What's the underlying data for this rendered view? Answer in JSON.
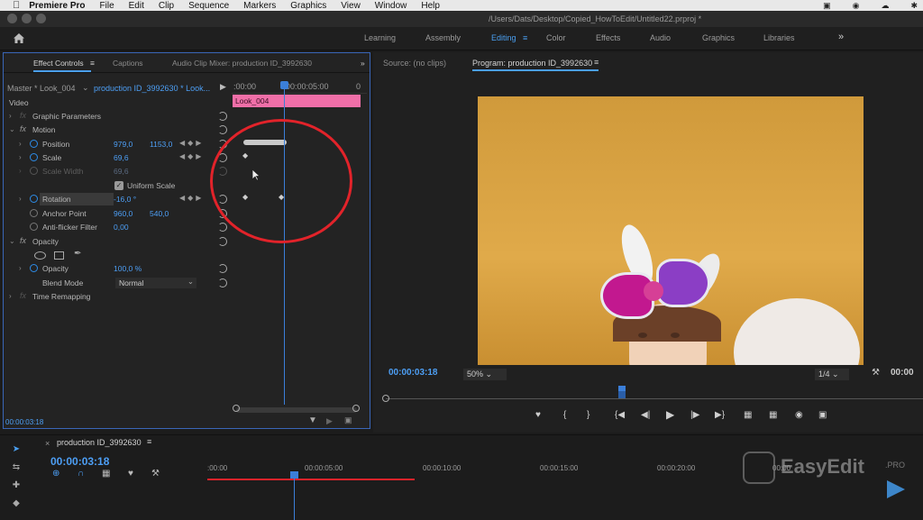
{
  "menubar": {
    "app": "Premiere Pro",
    "items": [
      "File",
      "Edit",
      "Clip",
      "Sequence",
      "Markers",
      "Graphics",
      "View",
      "Window",
      "Help"
    ]
  },
  "window": {
    "path": "/Users/Dats/Desktop/Copied_HowToEdit/Untitled22.prproj *"
  },
  "workspaces": {
    "tabs": [
      "Learning",
      "Assembly",
      "Editing",
      "Color",
      "Effects",
      "Audio",
      "Graphics",
      "Libraries"
    ],
    "active": "Editing",
    "more": "»"
  },
  "effect_controls": {
    "tabs": [
      "Effect Controls",
      "Captions",
      "Audio Clip Mixer: production ID_3992630"
    ],
    "more": "»",
    "master": "Master * Look_004",
    "sequence": "production ID_3992630 * Look...",
    "ruler": {
      "start": ":00:00",
      "mid": "00:00:05:00",
      "end": "0"
    },
    "clip_label": "Look_004",
    "section_video": "Video",
    "graphic_parameters": "Graphic Parameters",
    "motion": "Motion",
    "position": {
      "label": "Position",
      "x": "979,0",
      "y": "1153,0"
    },
    "scale": {
      "label": "Scale",
      "value": "69,6"
    },
    "scale_width": {
      "label": "Scale Width",
      "value": "69,6"
    },
    "uniform_scale": "Uniform Scale",
    "rotation": {
      "label": "Rotation",
      "value": "-16,0 °"
    },
    "anchor_point": {
      "label": "Anchor Point",
      "x": "960,0",
      "y": "540,0"
    },
    "anti_flicker": {
      "label": "Anti-flicker Filter",
      "value": "0,00"
    },
    "opacity_section": "Opacity",
    "opacity": {
      "label": "Opacity",
      "value": "100,0 %"
    },
    "blend_mode": {
      "label": "Blend Mode",
      "value": "Normal"
    },
    "time_remapping": "Time Remapping",
    "timecode": "00:00:03:18"
  },
  "program_monitor": {
    "source_tab": "Source: (no clips)",
    "program_tab": "Program: production ID_3992630",
    "timecode": "00:00:03:18",
    "zoom": "50%",
    "resolution": "1/4",
    "duration": "00:00"
  },
  "timeline": {
    "sequence": "production ID_3992630",
    "timecode": "00:00:03:18",
    "ticks": [
      ":00:00",
      "00:00:05:00",
      "00:00:10:00",
      "00:00:15:00",
      "00:00:20:00",
      "00:00"
    ]
  },
  "watermark": {
    "brand": "EasyEdit",
    "suffix": ".PRO"
  },
  "colors": {
    "accent": "#4a9ff0",
    "clip": "#f06fa8",
    "annotation": "#e2232a",
    "image_bg": "#d9a23f"
  }
}
